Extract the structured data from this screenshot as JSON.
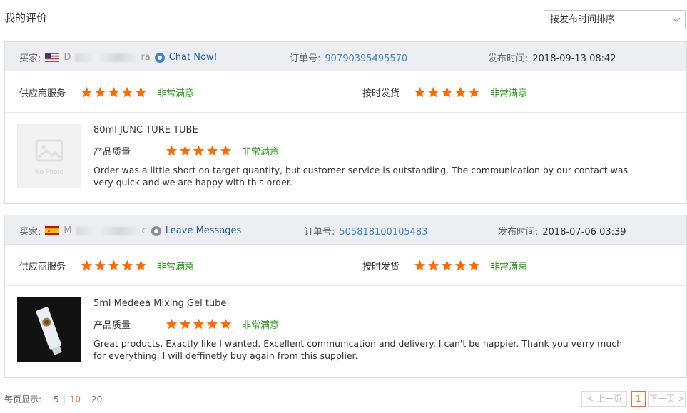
{
  "page_title": "我的评价",
  "sort": {
    "selected": "按发布时间排序"
  },
  "labels": {
    "buyer": "买家:",
    "order": "订单号:",
    "published": "发布时间:",
    "supplier_service": "供应商服务",
    "on_time_delivery": "按时发货",
    "product_quality": "产品质量"
  },
  "reviews": [
    {
      "buyer_flag": "us-flag",
      "buyer_name_visible": "D",
      "buyer_name_suffix": "ra",
      "contact_label": "Chat Now!",
      "order_number": "90790395495570",
      "published_time": "2018-09-13 08:42",
      "supplier_service_rating": 5,
      "supplier_service_text": "非常满意",
      "delivery_rating": 5,
      "delivery_text": "非常满意",
      "product_name": "80ml JUNC TURE TUBE",
      "product_image": "No Photo",
      "quality_rating": 5,
      "quality_text": "非常满意",
      "comment": "Order was a little short on target quantity, but customer service is outstanding. The communication by our contact was very quick and we are happy with this order."
    },
    {
      "buyer_flag": "es-flag",
      "buyer_name_visible": "M",
      "buyer_name_suffix": "c",
      "contact_label": "Leave Messages",
      "order_number": "505818100105483",
      "published_time": "2018-07-06 03:39",
      "supplier_service_rating": 5,
      "supplier_service_text": "非常满意",
      "delivery_rating": 5,
      "delivery_text": "非常满意",
      "product_name": "5ml Medeea Mixing Gel tube",
      "product_image": "product-photo",
      "quality_rating": 5,
      "quality_text": "非常满意",
      "comment": "Great products. Exactly like I wanted. Excellent communication and delivery. I can't be happier. Thank you verry much for everything. I will deffinetly buy again from this supplier."
    }
  ],
  "footer": {
    "per_page_label": "每页显示:",
    "options": [
      "5",
      "10",
      "20"
    ],
    "selected_option": "10"
  },
  "pager": {
    "prev": "< 上一页",
    "current": "1",
    "next": "下一页 >"
  },
  "colors": {
    "star": "#ff6a00",
    "satisfied": "#2e9a1d",
    "link": "#3a85d2",
    "accent": "#f46b2a"
  }
}
